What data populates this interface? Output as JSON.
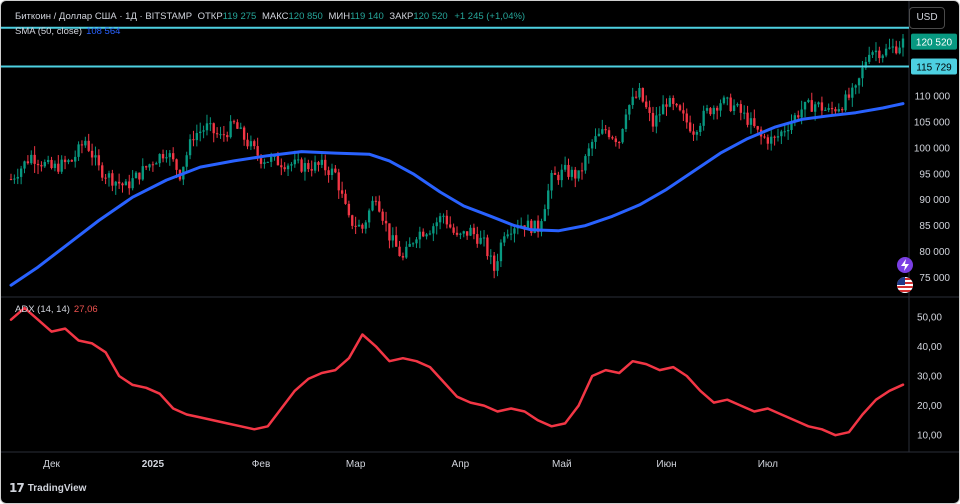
{
  "header": {
    "symbol": "Биткоин / Доллар США · 1Д · BITSTAMP",
    "open_label": "ОТКР",
    "open_value": "119 275",
    "high_label": "МАКС",
    "high_value": "120 850",
    "low_label": "МИН",
    "low_value": "119 140",
    "close_label": "ЗАКР",
    "close_value": "120 520",
    "change": "+1 245 (+1,04%)"
  },
  "currency_button": "USD",
  "indicators": {
    "sma_label": "SMA (50, close)",
    "sma_value": "108 564",
    "adx_label": "ADX (14, 14)",
    "adx_value": "27,06"
  },
  "branding": {
    "name": "TradingView"
  },
  "colors": {
    "background": "#000000",
    "up": "#089981",
    "down": "#f23645",
    "sma": "#2962ff",
    "adx": "#f23645",
    "hline": "#4dd0e1",
    "text": "#d1d4dc"
  },
  "chart_data": {
    "type": "candlestick",
    "price_axis": {
      "ticks": [
        75000,
        80000,
        85000,
        90000,
        95000,
        100000,
        105000,
        110000
      ],
      "tick_labels": [
        "75 000",
        "80 000",
        "85 000",
        "90 000",
        "95 000",
        "100 000",
        "105 000",
        "110 000"
      ],
      "ylim": [
        72000,
        124500
      ]
    },
    "time_axis": {
      "labels": [
        "Дек",
        "2025",
        "Фев",
        "Мар",
        "Апр",
        "Май",
        "Июн",
        "Июл"
      ],
      "label_days": [
        0,
        30,
        62,
        90,
        121,
        151,
        182,
        212
      ]
    },
    "horizontal_lines": [
      {
        "price": 123200,
        "label": ""
      },
      {
        "price": 115729,
        "label": "115 729"
      }
    ],
    "last_price_label": "120 520",
    "last_price": 120520,
    "candles_ohlc": [],
    "sma_50": [
      [
        -12,
        73500
      ],
      [
        -4,
        77000
      ],
      [
        5,
        81500
      ],
      [
        14,
        86000
      ],
      [
        24,
        90500
      ],
      [
        34,
        93800
      ],
      [
        44,
        96300
      ],
      [
        54,
        97500
      ],
      [
        64,
        98500
      ],
      [
        74,
        99300
      ],
      [
        84,
        99000
      ],
      [
        94,
        98800
      ],
      [
        100,
        97500
      ],
      [
        107,
        95000
      ],
      [
        115,
        91500
      ],
      [
        122,
        88800
      ],
      [
        130,
        86800
      ],
      [
        137,
        85000
      ],
      [
        142,
        84200
      ],
      [
        150,
        84000
      ],
      [
        158,
        85000
      ],
      [
        166,
        86800
      ],
      [
        174,
        89000
      ],
      [
        182,
        92000
      ],
      [
        190,
        95500
      ],
      [
        198,
        99000
      ],
      [
        206,
        101800
      ],
      [
        214,
        104000
      ],
      [
        222,
        105500
      ],
      [
        230,
        106200
      ],
      [
        238,
        106800
      ],
      [
        246,
        107700
      ],
      [
        252,
        108564
      ]
    ],
    "adx_axis": {
      "ticks": [
        10,
        20,
        30,
        40,
        50
      ],
      "tick_labels": [
        "10,00",
        "20,00",
        "30,00",
        "40,00",
        "50,00"
      ],
      "ylim": [
        5,
        56
      ]
    },
    "adx": [
      [
        -12,
        49
      ],
      [
        -8,
        53
      ],
      [
        -4,
        49
      ],
      [
        0,
        45
      ],
      [
        4,
        46
      ],
      [
        8,
        42
      ],
      [
        12,
        41
      ],
      [
        16,
        38
      ],
      [
        20,
        30
      ],
      [
        24,
        27
      ],
      [
        28,
        26
      ],
      [
        32,
        24
      ],
      [
        36,
        19
      ],
      [
        40,
        17
      ],
      [
        44,
        16
      ],
      [
        48,
        15
      ],
      [
        52,
        14
      ],
      [
        56,
        13
      ],
      [
        60,
        12
      ],
      [
        64,
        13
      ],
      [
        68,
        19
      ],
      [
        72,
        25
      ],
      [
        76,
        29
      ],
      [
        80,
        31
      ],
      [
        84,
        32
      ],
      [
        88,
        36
      ],
      [
        92,
        44
      ],
      [
        96,
        40
      ],
      [
        100,
        35
      ],
      [
        104,
        36
      ],
      [
        108,
        35
      ],
      [
        112,
        33
      ],
      [
        116,
        28
      ],
      [
        120,
        23
      ],
      [
        124,
        21
      ],
      [
        128,
        20
      ],
      [
        132,
        18
      ],
      [
        136,
        19
      ],
      [
        140,
        18
      ],
      [
        144,
        15
      ],
      [
        148,
        13
      ],
      [
        152,
        14
      ],
      [
        156,
        20
      ],
      [
        160,
        30
      ],
      [
        164,
        32
      ],
      [
        168,
        31
      ],
      [
        172,
        35
      ],
      [
        176,
        34
      ],
      [
        180,
        32
      ],
      [
        184,
        33
      ],
      [
        188,
        30
      ],
      [
        192,
        25
      ],
      [
        196,
        21
      ],
      [
        200,
        22
      ],
      [
        204,
        20
      ],
      [
        208,
        18
      ],
      [
        212,
        19
      ],
      [
        216,
        17
      ],
      [
        220,
        15
      ],
      [
        224,
        13
      ],
      [
        228,
        12
      ],
      [
        232,
        10
      ],
      [
        236,
        11
      ],
      [
        240,
        17
      ],
      [
        244,
        22
      ],
      [
        248,
        25
      ],
      [
        252,
        27.06
      ]
    ]
  }
}
